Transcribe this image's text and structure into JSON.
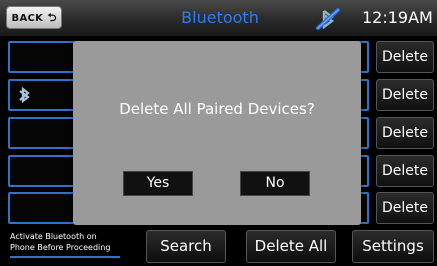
{
  "topbar": {
    "back_label": "BACK",
    "back_icon": "return-arrow-icon",
    "title": "Bluetooth",
    "status_icon": "bluetooth-disabled-icon",
    "clock": "12:19AM"
  },
  "devices": [
    {
      "delete_label": "Delete",
      "icon": ""
    },
    {
      "delete_label": "Delete",
      "icon": "bluetooth-icon"
    },
    {
      "delete_label": "Delete",
      "icon": ""
    },
    {
      "delete_label": "Delete",
      "icon": ""
    },
    {
      "delete_label": "Delete",
      "icon": ""
    }
  ],
  "bottom": {
    "hint_line1": "Activate Bluetooth on",
    "hint_line2": "Phone Before Proceeding",
    "search_label": "Search",
    "delete_all_label": "Delete All",
    "settings_label": "Settings"
  },
  "modal": {
    "message": "Delete All Paired Devices?",
    "yes_label": "Yes",
    "no_label": "No"
  },
  "colors": {
    "accent": "#2e7cf0",
    "slot_border": "#2f72c8",
    "modal_bg": "#9a9a9a"
  }
}
